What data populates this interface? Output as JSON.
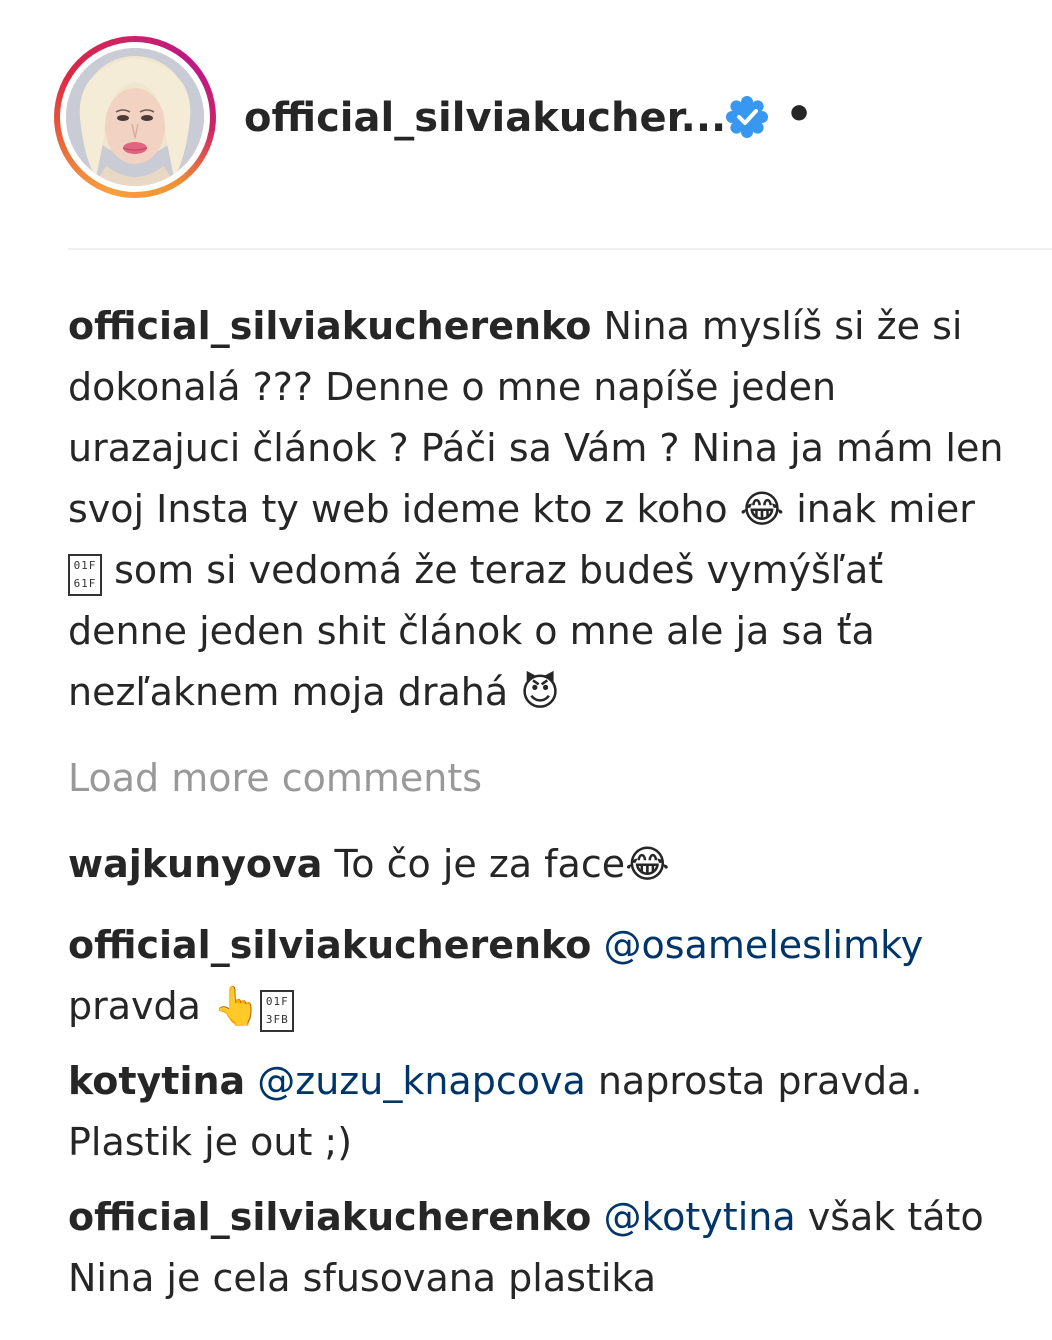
{
  "header": {
    "username": "official_silviakucher...",
    "verified_icon": "verified-badge-icon",
    "dot": "•",
    "colors": {
      "verified": "#3897f0",
      "ring_start": "#f09433",
      "ring_end": "#bc1888"
    }
  },
  "caption": {
    "username": "official_silviakucherenko",
    "text_1": " Nina myslíš si že si dokonalá ??? Denne o mne napíše jeden urazajuci článok ? Páči sa Vám ? Nina ja mám len svoj Insta ty web ideme kto z koho ",
    "emoji_1": "😂",
    "text_2": " inak mier ",
    "tofu_1": "01F 61F",
    "text_3": " som si vedomá že teraz budeš vymýšľať denne jeden shit článok o mne ale ja sa ťa nezľaknem moja drahá ",
    "emoji_2": "😈"
  },
  "load_more": "Load more comments",
  "comments": [
    {
      "username": "wajkunyova",
      "text": " To čo je za face",
      "emoji": "😂"
    },
    {
      "username": "official_silviakucherenko",
      "mention": " @osameleslimky",
      "text": " pravda ",
      "emoji": "👆",
      "tofu": "01F 3FB"
    },
    {
      "username": "kotytina",
      "mention": " @zuzu_knapcova",
      "text": " naprosta pravda. Plastik je out ;)"
    },
    {
      "username": "official_silviakucherenko",
      "mention": " @kotytina",
      "text": " však táto Nina je cela sfusovana plastika"
    }
  ]
}
